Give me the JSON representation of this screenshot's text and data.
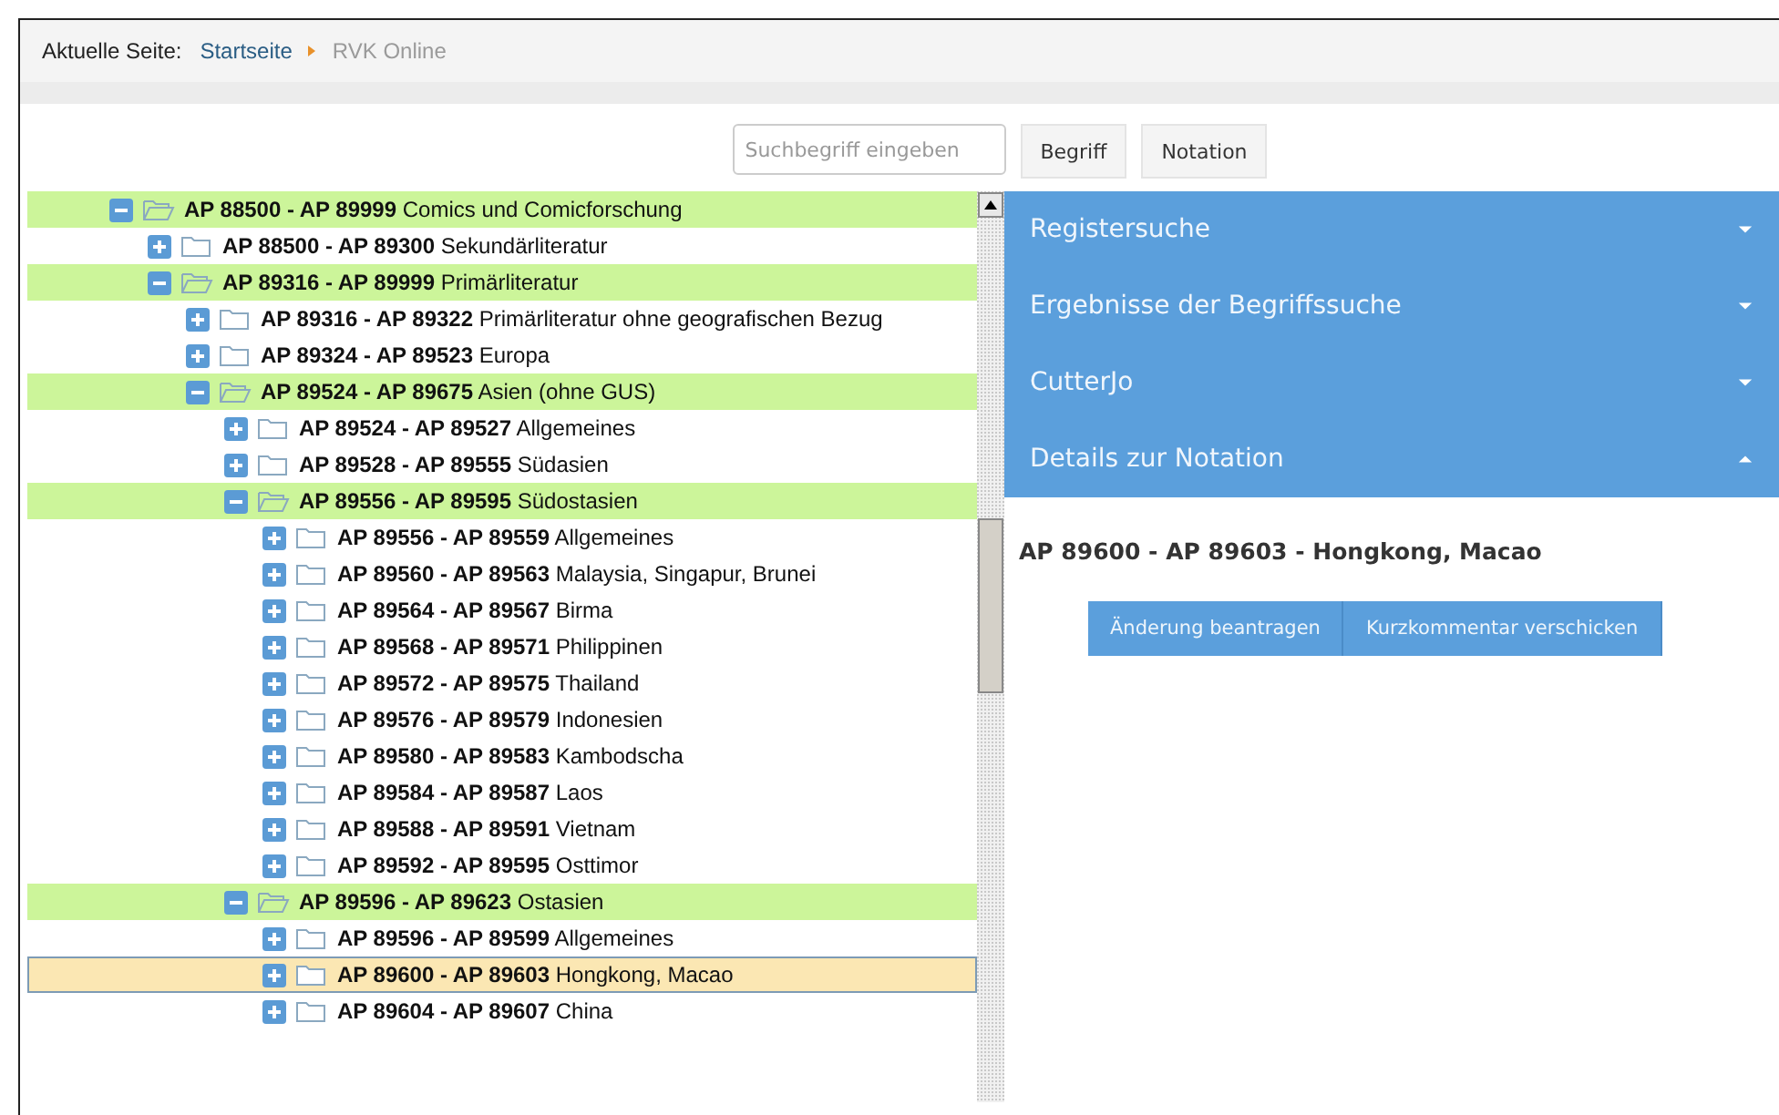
{
  "breadcrumb": {
    "label": "Aktuelle Seite:",
    "links": [
      {
        "text": "Startseite",
        "current": false
      },
      {
        "text": "RVK Online",
        "current": true
      }
    ]
  },
  "search": {
    "placeholder": "Suchbegriff eingeben",
    "buttons": [
      "Begriff",
      "Notation"
    ]
  },
  "tree": [
    {
      "notation": "AP 88500 - AP 89999",
      "label": "Comics und Comicforschung",
      "expanded": true,
      "selected": false,
      "children": [
        {
          "notation": "AP 88500 - AP 89300",
          "label": "Sekundärliteratur",
          "expanded": false,
          "selected": false
        },
        {
          "notation": "AP 89316 - AP 89999",
          "label": "Primärliteratur",
          "expanded": true,
          "selected": false,
          "children": [
            {
              "notation": "AP 89316 - AP 89322",
              "label": "Primärliteratur ohne geografischen Bezug",
              "expanded": false,
              "selected": false
            },
            {
              "notation": "AP 89324 - AP 89523",
              "label": "Europa",
              "expanded": false,
              "selected": false
            },
            {
              "notation": "AP 89524 - AP 89675",
              "label": "Asien (ohne GUS)",
              "expanded": true,
              "selected": false,
              "children": [
                {
                  "notation": "AP 89524 - AP 89527",
                  "label": "Allgemeines",
                  "expanded": false,
                  "selected": false
                },
                {
                  "notation": "AP 89528 - AP 89555",
                  "label": "Südasien",
                  "expanded": false,
                  "selected": false
                },
                {
                  "notation": "AP 89556 - AP 89595",
                  "label": "Südostasien",
                  "expanded": true,
                  "selected": false,
                  "children": [
                    {
                      "notation": "AP 89556 - AP 89559",
                      "label": "Allgemeines",
                      "expanded": false,
                      "selected": false
                    },
                    {
                      "notation": "AP 89560 - AP 89563",
                      "label": "Malaysia, Singapur, Brunei",
                      "expanded": false,
                      "selected": false
                    },
                    {
                      "notation": "AP 89564 - AP 89567",
                      "label": "Birma",
                      "expanded": false,
                      "selected": false
                    },
                    {
                      "notation": "AP 89568 - AP 89571",
                      "label": "Philippinen",
                      "expanded": false,
                      "selected": false
                    },
                    {
                      "notation": "AP 89572 - AP 89575",
                      "label": "Thailand",
                      "expanded": false,
                      "selected": false
                    },
                    {
                      "notation": "AP 89576 - AP 89579",
                      "label": "Indonesien",
                      "expanded": false,
                      "selected": false
                    },
                    {
                      "notation": "AP 89580 - AP 89583",
                      "label": "Kambodscha",
                      "expanded": false,
                      "selected": false
                    },
                    {
                      "notation": "AP 89584 - AP 89587",
                      "label": "Laos",
                      "expanded": false,
                      "selected": false
                    },
                    {
                      "notation": "AP 89588 - AP 89591",
                      "label": "Vietnam",
                      "expanded": false,
                      "selected": false
                    },
                    {
                      "notation": "AP 89592 - AP 89595",
                      "label": "Osttimor",
                      "expanded": false,
                      "selected": false
                    }
                  ]
                },
                {
                  "notation": "AP 89596 - AP 89623",
                  "label": "Ostasien",
                  "expanded": true,
                  "selected": false,
                  "children": [
                    {
                      "notation": "AP 89596 - AP 89599",
                      "label": "Allgemeines",
                      "expanded": false,
                      "selected": false
                    },
                    {
                      "notation": "AP 89600 - AP 89603",
                      "label": "Hongkong, Macao",
                      "expanded": false,
                      "selected": true
                    },
                    {
                      "notation": "AP 89604 - AP 89607",
                      "label": "China",
                      "expanded": false,
                      "selected": false
                    }
                  ]
                }
              ]
            }
          ]
        }
      ]
    }
  ],
  "accordion": [
    {
      "title": "Registersuche",
      "expanded": false
    },
    {
      "title": "Ergebnisse der Begriffssuche",
      "expanded": false
    },
    {
      "title": "CutterJo",
      "expanded": false
    },
    {
      "title": "Details zur Notation",
      "expanded": true
    }
  ],
  "details": {
    "title": "AP 89600 - AP 89603 - Hongkong, Macao",
    "buttons": [
      "Änderung beantragen",
      "Kurzkommentar verschicken"
    ]
  }
}
